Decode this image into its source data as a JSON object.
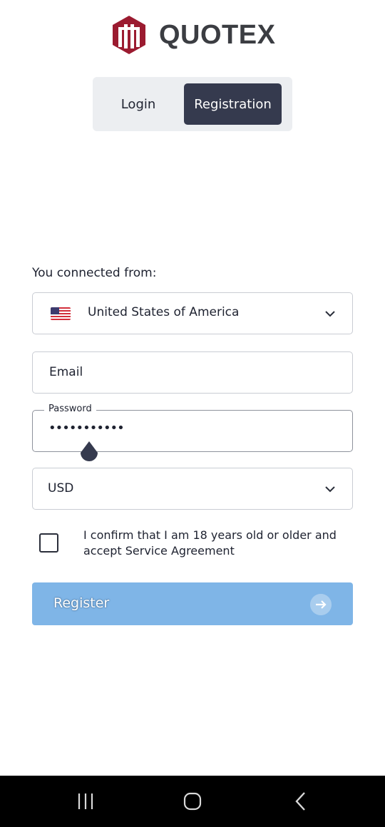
{
  "brand": {
    "name": "QUOTEX",
    "logo_color": "#9b1b30"
  },
  "tabs": [
    {
      "label": "Login",
      "active": false
    },
    {
      "label": "Registration",
      "active": true
    }
  ],
  "form": {
    "connected_label": "You connected from:",
    "country": {
      "value": "United States of America",
      "icon": "us-flag-icon"
    },
    "email": {
      "placeholder": "Email",
      "value": ""
    },
    "password": {
      "label": "Password",
      "value": "•••••••••••"
    },
    "currency": {
      "value": "USD"
    },
    "terms": {
      "checked": false,
      "text": "I confirm that I am 18 years old or older and accept Service Agreement"
    },
    "register_label": "Register"
  },
  "colors": {
    "active_tab": "#353a4e",
    "register_button": "#7fb5e7",
    "text": "#1e2230"
  },
  "system_nav": {
    "icons": [
      "recents-icon",
      "home-icon",
      "back-icon"
    ]
  }
}
